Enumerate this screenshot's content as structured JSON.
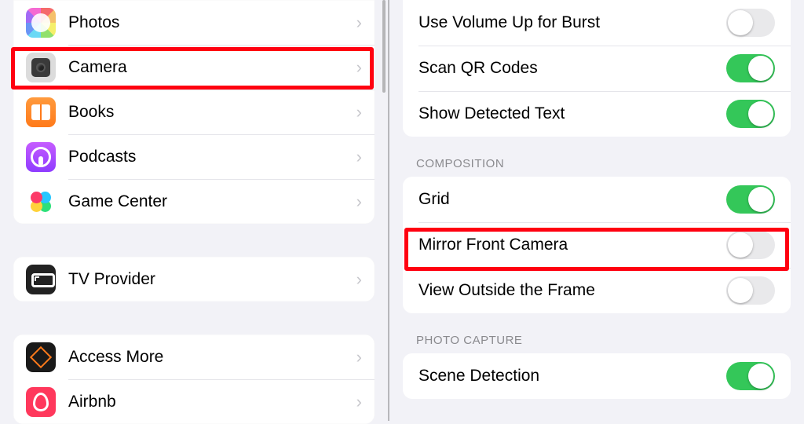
{
  "sidebar": {
    "groups": [
      {
        "items": [
          {
            "label": "Photos",
            "icon": "photos"
          },
          {
            "label": "Camera",
            "icon": "camera",
            "highlight": true
          },
          {
            "label": "Books",
            "icon": "books"
          },
          {
            "label": "Podcasts",
            "icon": "podcasts"
          },
          {
            "label": "Game Center",
            "icon": "gamecenter"
          }
        ]
      },
      {
        "items": [
          {
            "label": "TV Provider",
            "icon": "tvprovider"
          }
        ]
      },
      {
        "items": [
          {
            "label": "Access More",
            "icon": "accessmore"
          },
          {
            "label": "Airbnb",
            "icon": "airbnb"
          }
        ]
      }
    ]
  },
  "detail": {
    "groups": [
      {
        "header": "",
        "rows": [
          {
            "label": "Use Volume Up for Burst",
            "on": false
          },
          {
            "label": "Scan QR Codes",
            "on": true
          },
          {
            "label": "Show Detected Text",
            "on": true
          }
        ]
      },
      {
        "header": "COMPOSITION",
        "rows": [
          {
            "label": "Grid",
            "on": true
          },
          {
            "label": "Mirror Front Camera",
            "on": false,
            "highlight": true
          },
          {
            "label": "View Outside the Frame",
            "on": false
          }
        ]
      },
      {
        "header": "PHOTO CAPTURE",
        "rows": [
          {
            "label": "Scene Detection",
            "on": true
          }
        ]
      }
    ]
  },
  "colors": {
    "highlight": "#ff0010",
    "toggle_on": "#34c759"
  }
}
